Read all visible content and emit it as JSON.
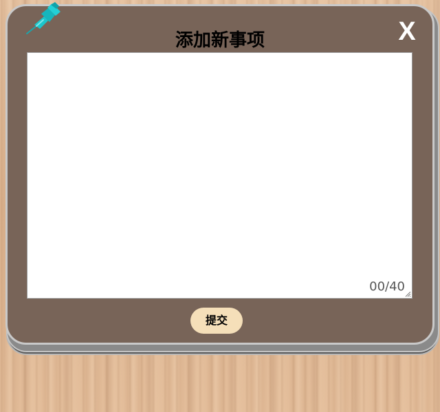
{
  "dialog": {
    "title": "添加新事项",
    "close_label": "X",
    "pin_icon": "pushpin-icon",
    "close_icon": "close-x-icon"
  },
  "editor": {
    "value": "",
    "placeholder": "",
    "counter": "00/40",
    "max_length": 40
  },
  "actions": {
    "submit_label": "提交"
  },
  "colors": {
    "card_background": "#786458",
    "card_border": "#c9c9c9",
    "pin": "#1bc6cc",
    "submit_background": "#f5dfb9",
    "wood_background": "#e0b894",
    "close_text": "#ffffff"
  }
}
